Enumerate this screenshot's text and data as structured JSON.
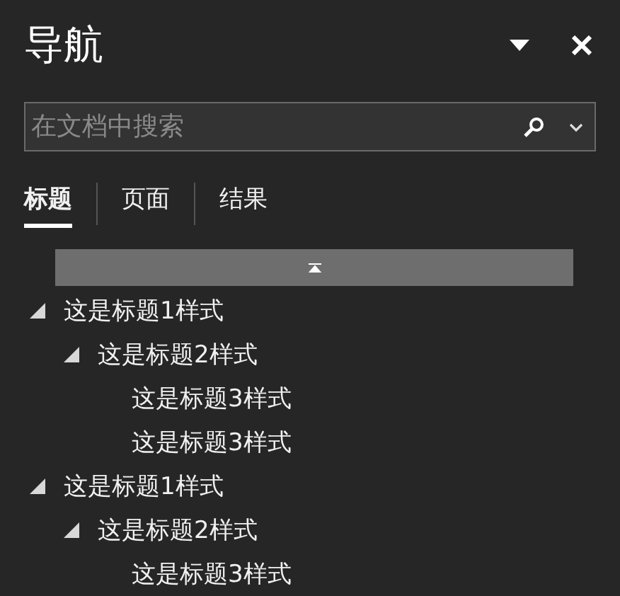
{
  "pane": {
    "title": "导航"
  },
  "search": {
    "placeholder": "在文档中搜索"
  },
  "tabs": [
    {
      "label": "标题",
      "selected": true
    },
    {
      "label": "页面",
      "selected": false
    },
    {
      "label": "结果",
      "selected": false
    }
  ],
  "headings": [
    {
      "text": "这是标题1样式",
      "expanded": true,
      "children": [
        {
          "text": "这是标题2样式",
          "expanded": true,
          "children": [
            {
              "text": "这是标题3样式"
            },
            {
              "text": "这是标题3样式"
            }
          ]
        }
      ]
    },
    {
      "text": "这是标题1样式",
      "expanded": true,
      "children": [
        {
          "text": "这是标题2样式",
          "expanded": true,
          "children": [
            {
              "text": "这是标题3样式"
            }
          ]
        }
      ]
    }
  ]
}
